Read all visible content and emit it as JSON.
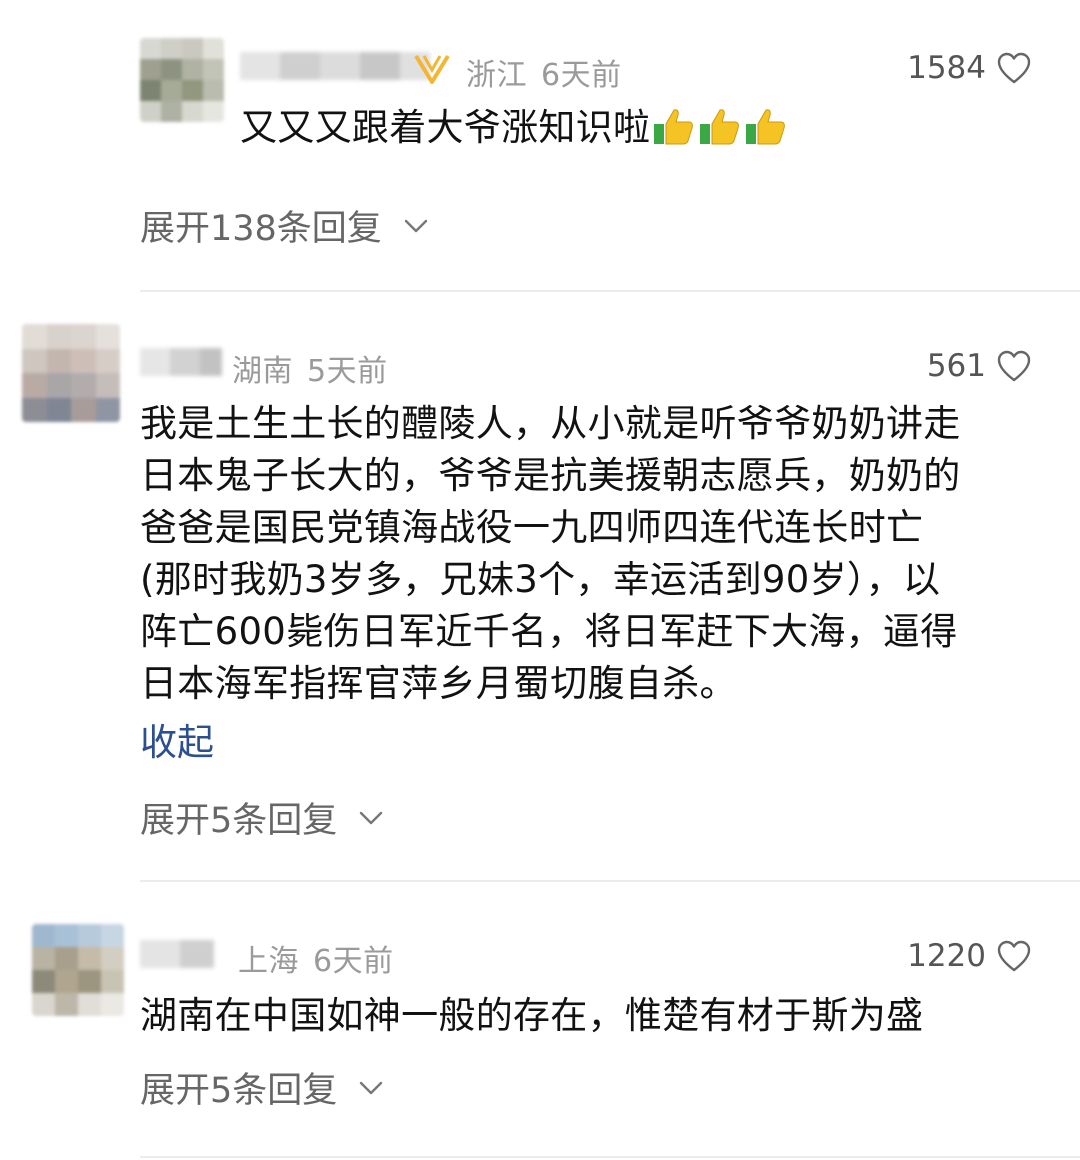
{
  "comments": [
    {
      "location": "浙江",
      "time": "6天前",
      "likes": "1584",
      "text": "又又又跟着大爷涨知识啦",
      "emoji_count": 3,
      "expand_replies": "展开138条回复",
      "has_vip_badge": true
    },
    {
      "location": "湖南",
      "time": "5天前",
      "likes": "561",
      "text": "我是土生土长的醴陵人，从小就是听爷爷奶奶讲走\n日本鬼子长大的，爷爷是抗美援朝志愿兵，奶奶的\n爸爸是国民党镇海战役一九四师四连代连长时亡\n(那时我奶3岁多，兄妹3个，幸运活到90岁），以\n阵亡600毙伤日军近千名，将日军赶下大海，逼得\n日本海军指挥官萍乡月蜀切腹自杀。",
      "collapse": "收起",
      "expand_replies": "展开5条回复"
    },
    {
      "location": "上海",
      "time": "6天前",
      "likes": "1220",
      "text": "湖南在中国如神一般的存在，惟楚有材于斯为盛",
      "expand_replies": "展开5条回复"
    }
  ],
  "colors": {
    "meta": "#9a9a9a",
    "link": "#2b4f8f",
    "divider": "#ececec",
    "thumb_yellow": "#f6c324",
    "thumb_green": "#3aa845"
  },
  "icons": {
    "like": "heart-outline-icon",
    "expand": "chevron-down-icon",
    "vip": "vip-badge-icon",
    "emoji": "thumbs-up-icon"
  }
}
